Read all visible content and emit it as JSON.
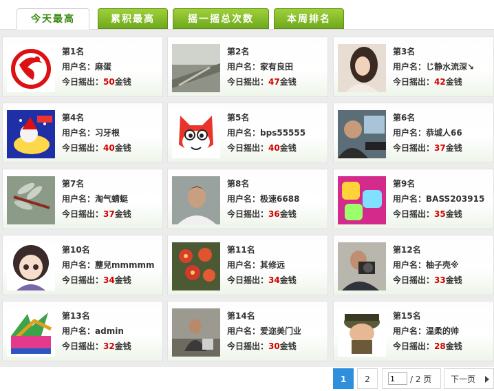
{
  "tabs": [
    {
      "label": "今天最高",
      "active": true
    },
    {
      "label": "累积最高",
      "active": false
    },
    {
      "label": "摇一摇总次数",
      "active": false
    },
    {
      "label": "本周排名",
      "active": false
    }
  ],
  "labels": {
    "username": "用户名：",
    "today": "今日摇出：",
    "unit": "金钱"
  },
  "ranks": [
    {
      "rank": "第1名",
      "user": "麻蛋",
      "amount": "50",
      "avatar": "red-dragon-logo"
    },
    {
      "rank": "第2名",
      "user": "家有良田",
      "amount": "47",
      "avatar": "landscape-photo"
    },
    {
      "rank": "第3名",
      "user": "じ静水流深↘",
      "amount": "42",
      "avatar": "woman-photo"
    },
    {
      "rank": "第4名",
      "user": "习牙根",
      "amount": "40",
      "avatar": "christmas-cartoon"
    },
    {
      "rank": "第5名",
      "user": "bps55555",
      "amount": "40",
      "avatar": "cartoon-fox"
    },
    {
      "rank": "第6名",
      "user": "恭城人66",
      "amount": "37",
      "avatar": "man-at-computer"
    },
    {
      "rank": "第7名",
      "user": "淘气蜻蜓",
      "amount": "37",
      "avatar": "dragonfly-photo"
    },
    {
      "rank": "第8名",
      "user": "极速6688",
      "amount": "36",
      "avatar": "young-man-photo"
    },
    {
      "rank": "第9名",
      "user": "BASS203915",
      "amount": "35",
      "avatar": "pink-text-graphic"
    },
    {
      "rank": "第10名",
      "user": "藶兒mmmmm",
      "amount": "34",
      "avatar": "anime-girl"
    },
    {
      "rank": "第11名",
      "user": "其修远",
      "amount": "34",
      "avatar": "orchid-flowers"
    },
    {
      "rank": "第12名",
      "user": "柚子壳※",
      "amount": "33",
      "avatar": "photographer-photo"
    },
    {
      "rank": "第13名",
      "user": "admin",
      "amount": "32",
      "avatar": "520-logo"
    },
    {
      "rank": "第14名",
      "user": "爱迩美门业",
      "amount": "30",
      "avatar": "worker-photo"
    },
    {
      "rank": "第15名",
      "user": "温柔的帅",
      "amount": "28",
      "avatar": "soldier-cartoon"
    }
  ],
  "pagination": {
    "pages": [
      "1",
      "2"
    ],
    "current": "1",
    "input_value": "1",
    "total": "/ 2 页",
    "next": "下一页"
  },
  "colors": {
    "accent": "#6fa91d",
    "amount": "#d40000",
    "current_page": "#2e8fdd"
  }
}
